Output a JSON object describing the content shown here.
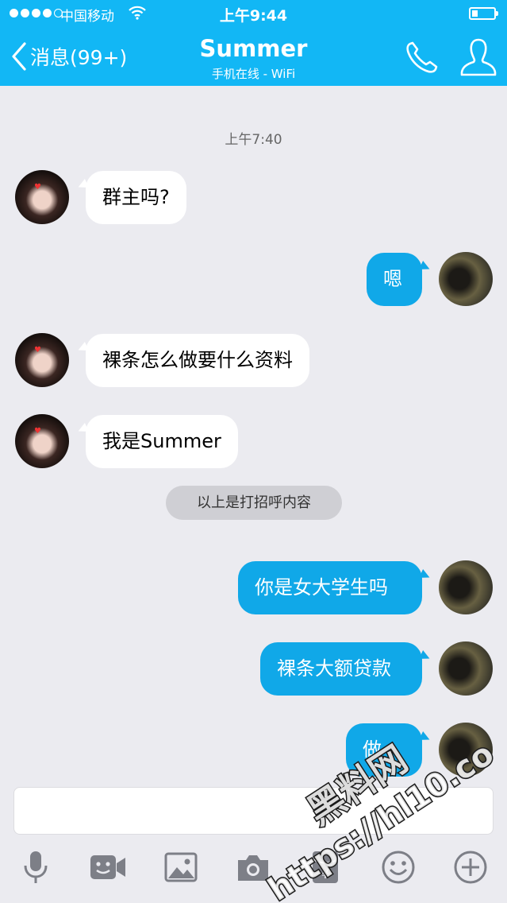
{
  "status_bar": {
    "carrier": "中国移动",
    "time": "上午9:44"
  },
  "header": {
    "back_label": "消息(99+)",
    "title": "Summer",
    "subtitle": "手机在线 - WiFi"
  },
  "chat": {
    "timestamp": "上午7:40",
    "messages": [
      {
        "side": "in",
        "text": "群主吗?"
      },
      {
        "side": "out",
        "text": "嗯"
      },
      {
        "side": "in",
        "text": "裸条怎么做要什么资料"
      },
      {
        "side": "in",
        "text": "我是Summer"
      },
      {
        "side": "out",
        "text": "你是女大学生吗"
      },
      {
        "side": "out",
        "text": "裸条大额贷款"
      },
      {
        "side": "out",
        "text": "做"
      }
    ],
    "notice": "以上是打招呼内容"
  },
  "input": {
    "value": ""
  },
  "toolbar": {
    "icons": [
      "microphone-icon",
      "video-icon",
      "image-icon",
      "camera-icon",
      "red-packet-icon",
      "emoji-icon",
      "plus-icon"
    ]
  },
  "watermark": {
    "line1": "黑料网",
    "line2": "https://hl10.co"
  },
  "colors": {
    "accent": "#12b7f5",
    "outgoing_bubble": "#10a8e8",
    "background": "#ebebf0"
  }
}
